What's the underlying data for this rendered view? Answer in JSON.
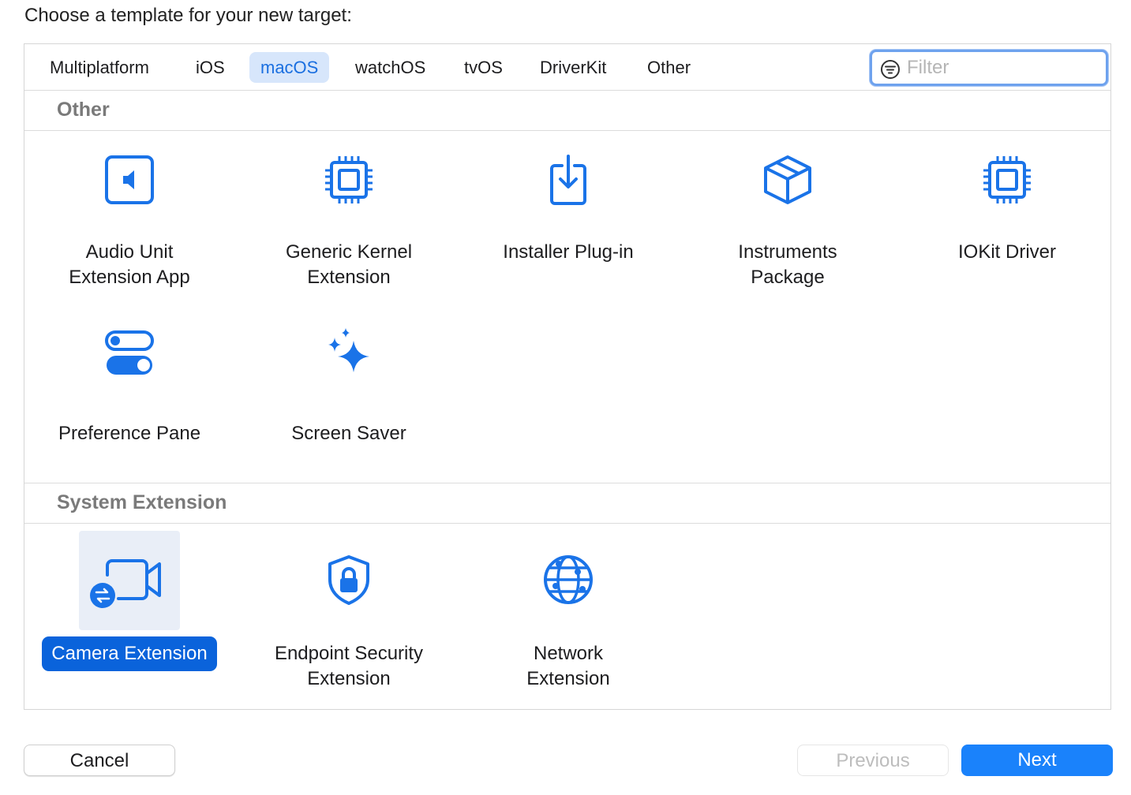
{
  "prompt": "Choose a template for your new target:",
  "tabs": [
    {
      "label": "Multiplatform"
    },
    {
      "label": "iOS"
    },
    {
      "label": "macOS"
    },
    {
      "label": "watchOS"
    },
    {
      "label": "tvOS"
    },
    {
      "label": "DriverKit"
    },
    {
      "label": "Other"
    }
  ],
  "active_tab": "macOS",
  "filter": {
    "placeholder": "Filter",
    "value": ""
  },
  "sections": [
    {
      "title": "Other",
      "items": [
        {
          "icon": "speaker-icon",
          "line1": "Audio Unit",
          "line2": "Extension App"
        },
        {
          "icon": "chip-icon",
          "line1": "Generic Kernel",
          "line2": "Extension"
        },
        {
          "icon": "download-tray-icon",
          "line1": "Installer Plug-in",
          "line2": ""
        },
        {
          "icon": "package-cube-icon",
          "line1": "Instruments",
          "line2": "Package"
        },
        {
          "icon": "chip-icon",
          "line1": "IOKit Driver",
          "line2": ""
        },
        {
          "icon": "toggles-icon",
          "line1": "Preference Pane",
          "line2": ""
        },
        {
          "icon": "sparkles-icon",
          "line1": "Screen Saver",
          "line2": ""
        }
      ]
    },
    {
      "title": "System Extension",
      "items": [
        {
          "icon": "camera-extension-icon",
          "line1": "Camera Extension",
          "line2": ""
        },
        {
          "icon": "shield-lock-icon",
          "line1": "Endpoint Security",
          "line2": "Extension"
        },
        {
          "icon": "globe-network-icon",
          "line1": "Network",
          "line2": "Extension"
        }
      ]
    }
  ],
  "selected_item": "Camera Extension",
  "buttons": {
    "cancel": "Cancel",
    "previous": "Previous",
    "next": "Next"
  },
  "colors": {
    "accent": "#1a82fb",
    "icon": "#1a73e8",
    "selection": "#0a63db",
    "section_title": "#7a7a7a"
  }
}
